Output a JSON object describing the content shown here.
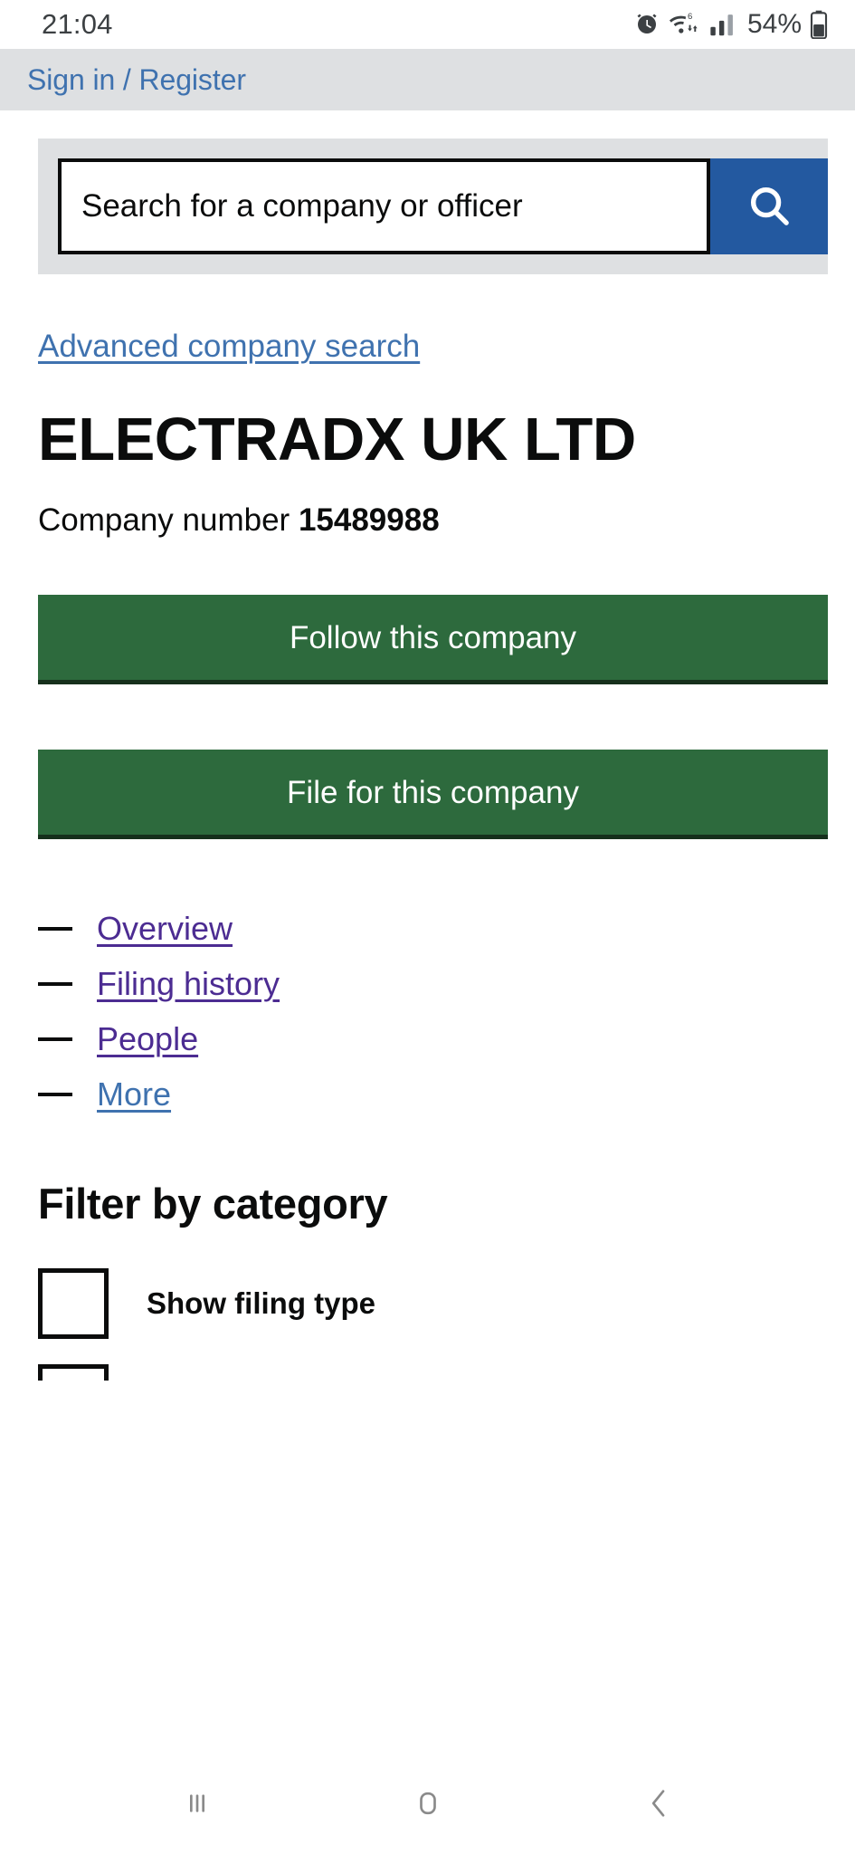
{
  "status_bar": {
    "time": "21:04",
    "battery_text": "54%",
    "icons": [
      "alarm-icon",
      "wifi-icon",
      "signal-icon",
      "battery-icon"
    ],
    "wifi_generation": "6"
  },
  "header": {
    "signin_label": "Sign in / Register"
  },
  "search": {
    "placeholder": "Search for a company or officer",
    "value": "",
    "button_icon": "search-icon",
    "button_color": "#2359a0"
  },
  "advanced_search": {
    "label": "Advanced company search"
  },
  "company": {
    "name": "ELECTRADX UK LTD",
    "number_label": "Company number",
    "number": "15489988"
  },
  "actions": {
    "follow_label": "Follow this company",
    "file_label": "File for this company",
    "button_color": "#2d6a3d"
  },
  "nav": {
    "items": [
      {
        "label": "Overview",
        "state": "visited"
      },
      {
        "label": "Filing history",
        "state": "visited"
      },
      {
        "label": "People",
        "state": "visited"
      },
      {
        "label": "More",
        "state": "unvisited"
      }
    ]
  },
  "filter": {
    "heading": "Filter by category",
    "options": [
      {
        "label": "Show filing type",
        "checked": false
      }
    ]
  },
  "android_nav": {
    "recents_icon": "recent-apps-icon",
    "home_icon": "home-icon",
    "back_icon": "back-chevron-icon"
  },
  "colors": {
    "link_blue": "#3f72af",
    "visited_purple": "#4c2c92",
    "grey_band": "#dee0e2",
    "text_black": "#0b0c0c"
  }
}
